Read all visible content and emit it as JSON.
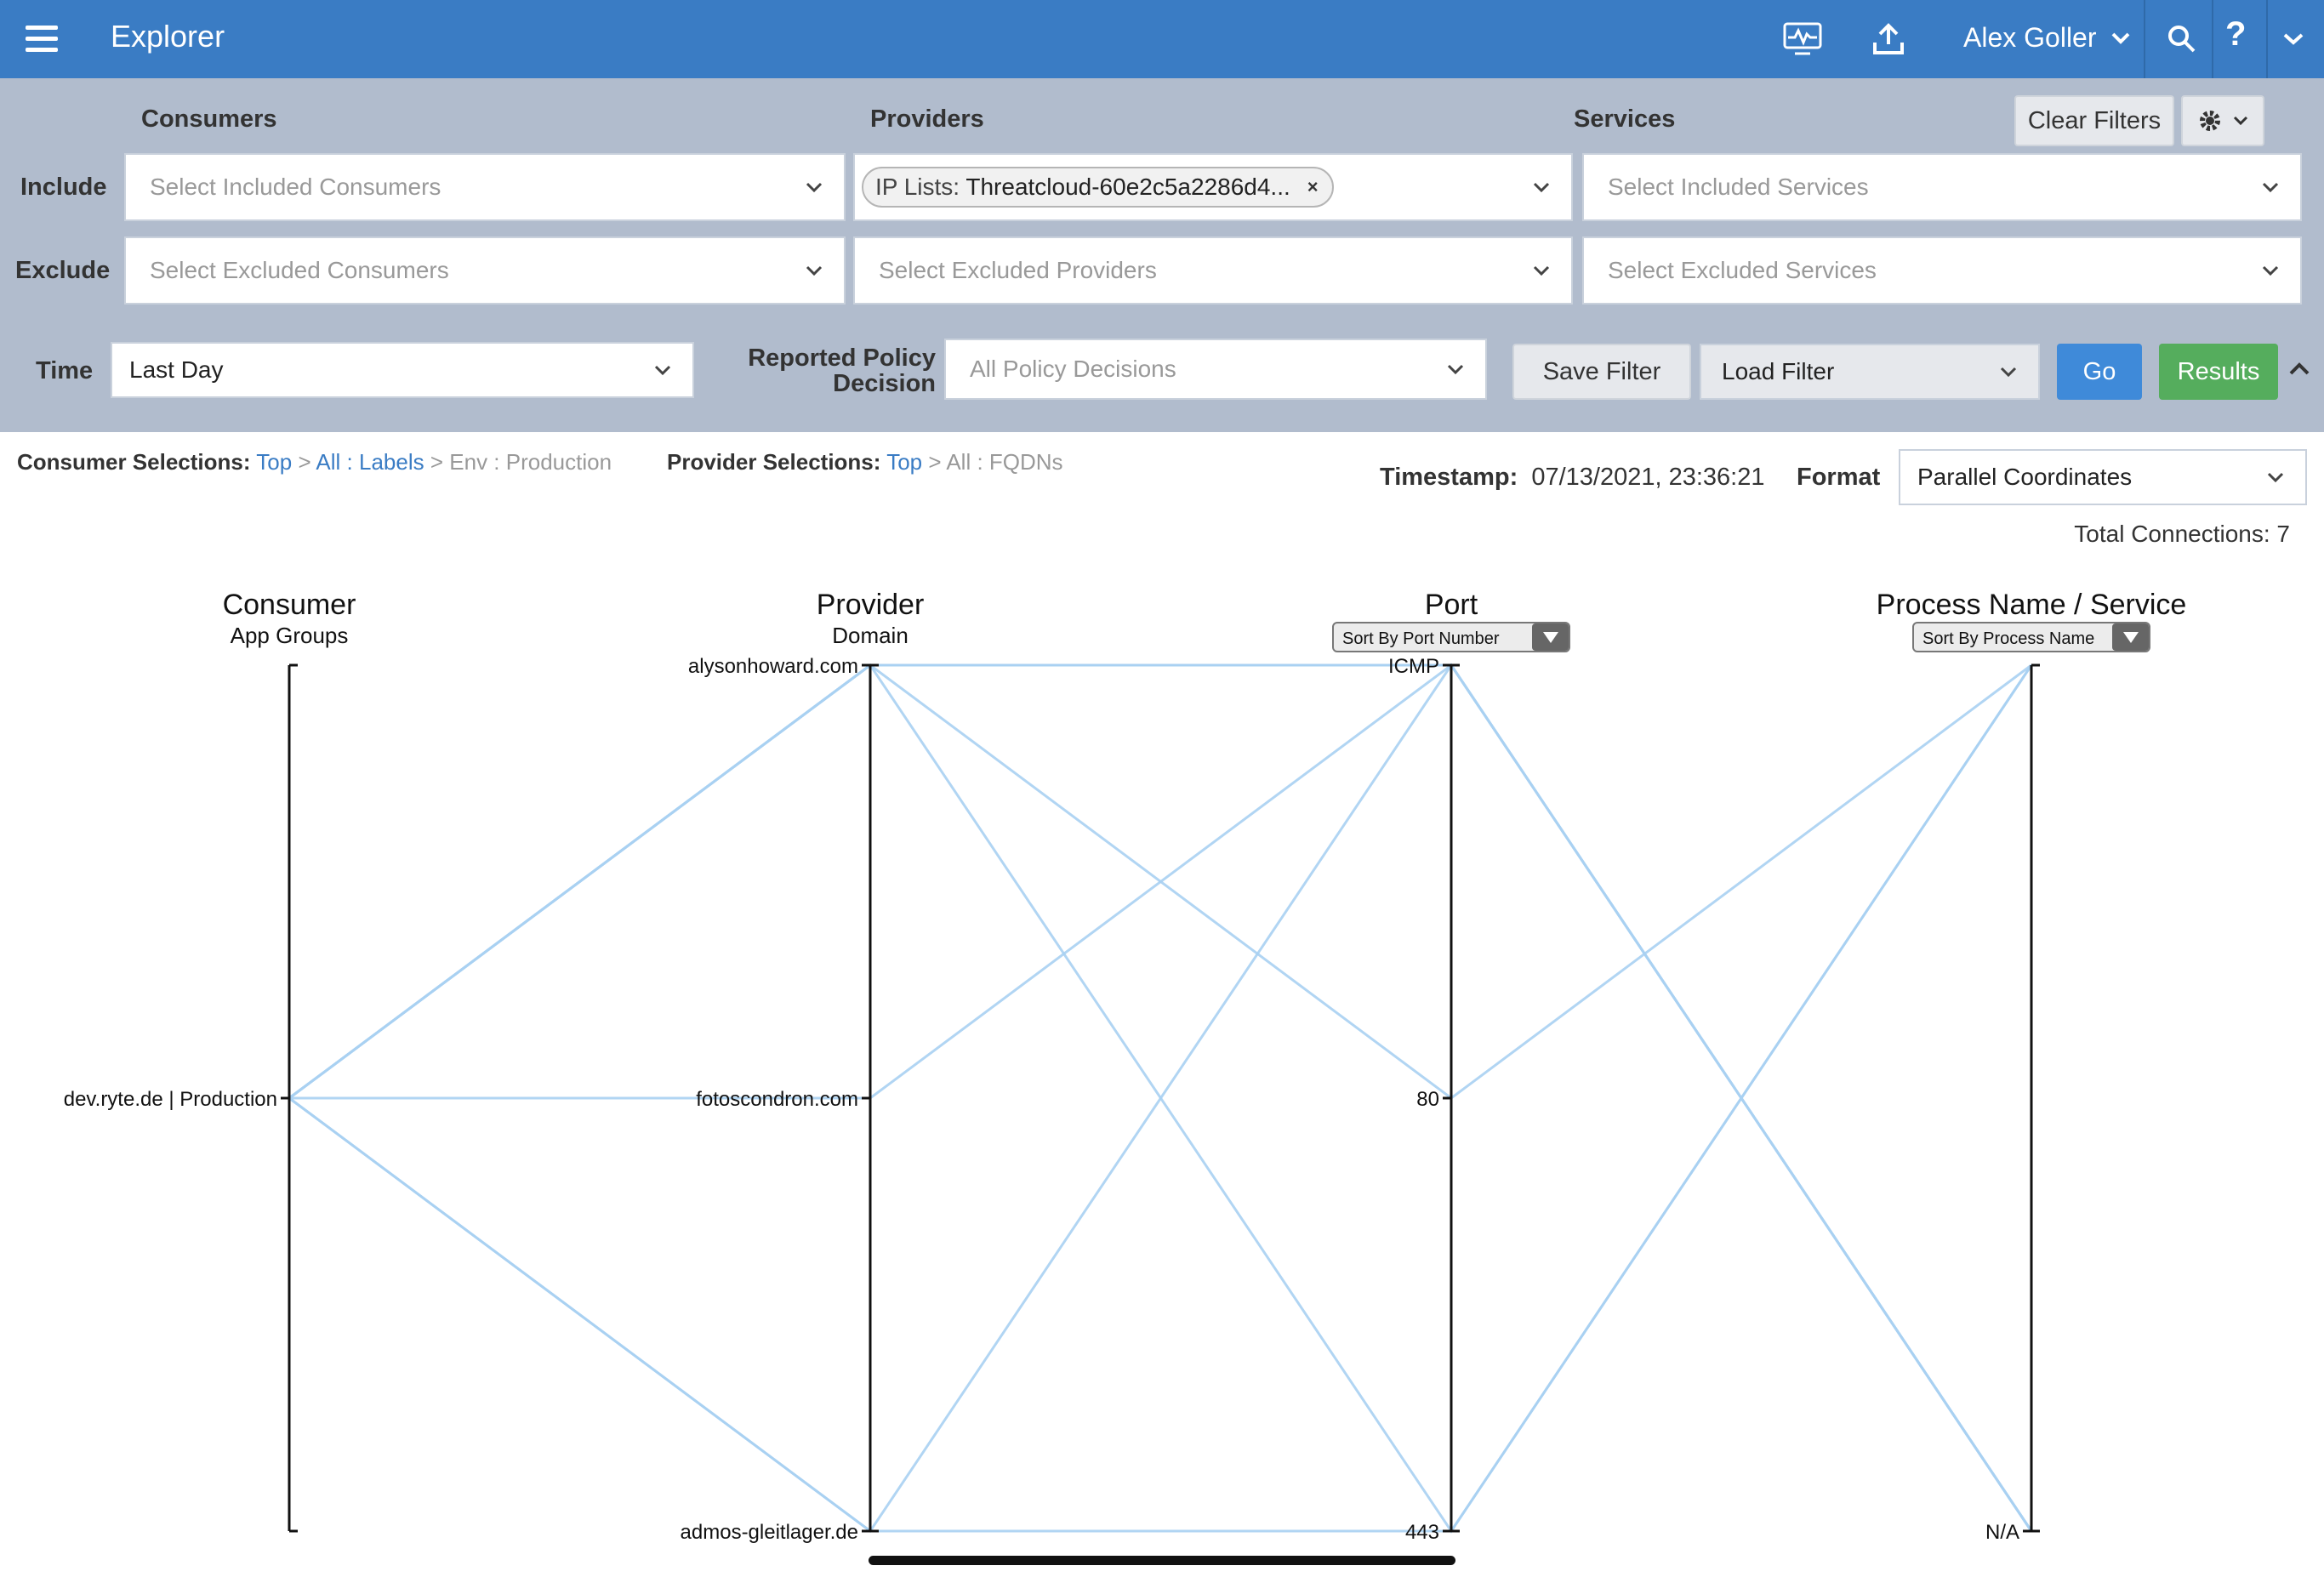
{
  "topbar": {
    "title": "Explorer",
    "user_name": "Alex Goller",
    "icons": [
      "menu-icon",
      "monitor-icon",
      "upload-icon",
      "chevron-down-icon",
      "search-icon",
      "help-icon",
      "chevron-down-icon"
    ],
    "help_label": "?",
    "colors": {
      "bar": "#3a7cc4"
    }
  },
  "filters": {
    "columns": {
      "consumers": "Consumers",
      "providers": "Providers",
      "services": "Services"
    },
    "rows": {
      "include": "Include",
      "exclude": "Exclude"
    },
    "include": {
      "consumers_placeholder": "Select Included Consumers",
      "provider_chip": {
        "prefix": "IP Lists:",
        "value": "Threatcloud-60e2c5a2286d4...",
        "remove": "×"
      },
      "services_placeholder": "Select Included Services"
    },
    "exclude": {
      "consumers_placeholder": "Select Excluded Consumers",
      "providers_placeholder": "Select Excluded Providers",
      "services_placeholder": "Select Excluded Services"
    },
    "clear_filters": "Clear Filters",
    "settings_icon": "gear-icon",
    "time_label": "Time",
    "time_value": "Last Day",
    "policy_label_line1": "Reported Policy",
    "policy_label_line2": "Decision",
    "policy_placeholder": "All Policy Decisions",
    "save_filter": "Save Filter",
    "load_filter": "Load Filter",
    "go": "Go",
    "results": "Results",
    "colors": {
      "panel": "#b1bccd",
      "go": "#3f8ad9",
      "results": "#55ad5d"
    }
  },
  "selections": {
    "consumer_label": "Consumer Selections:",
    "consumer_top": "Top",
    "consumer_sep1": ">",
    "consumer_all_labels": "All : Labels",
    "consumer_sep2": ">",
    "consumer_env": "Env : Production",
    "provider_label": "Provider Selections:",
    "provider_top": "Top",
    "provider_sep": ">",
    "provider_all": "All : FQDNs"
  },
  "meta": {
    "timestamp_label": "Timestamp:",
    "timestamp_value": "07/13/2021, 23:36:21",
    "format_label": "Format",
    "format_value": "Parallel Coordinates",
    "total_connections": "Total Connections: 7"
  },
  "chart_data": {
    "type": "parallel-coordinates",
    "axes": [
      {
        "title": "Consumer",
        "subtitle": "App Groups",
        "categories": [
          "dev.ryte.de | Production"
        ]
      },
      {
        "title": "Provider",
        "subtitle": "Domain",
        "categories": [
          "alysonhoward.com",
          "fotoscondron.com",
          "admos-gleitlager.de"
        ]
      },
      {
        "title": "Port",
        "sort_label": "Sort By Port Number",
        "categories": [
          "ICMP",
          "80",
          "443"
        ]
      },
      {
        "title": "Process Name / Service",
        "sort_label": "Sort By Process Name",
        "categories": [
          "",
          "N/A"
        ]
      }
    ],
    "connections": [
      [
        "dev.ryte.de | Production",
        "alysonhoward.com",
        "ICMP",
        "N/A"
      ],
      [
        "dev.ryte.de | Production",
        "alysonhoward.com",
        "80",
        ""
      ],
      [
        "dev.ryte.de | Production",
        "alysonhoward.com",
        "443",
        ""
      ],
      [
        "dev.ryte.de | Production",
        "fotoscondron.com",
        "ICMP",
        "N/A"
      ],
      [
        "dev.ryte.de | Production",
        "admos-gleitlager.de",
        "ICMP",
        "N/A"
      ],
      [
        "dev.ryte.de | Production",
        "alysonhoward.com",
        "ICMP",
        "N/A"
      ],
      [
        "dev.ryte.de | Production",
        "admos-gleitlager.de",
        "443",
        ""
      ]
    ],
    "line_color": "#a9d0f2",
    "line_color_dark": "#7fb6e8"
  }
}
